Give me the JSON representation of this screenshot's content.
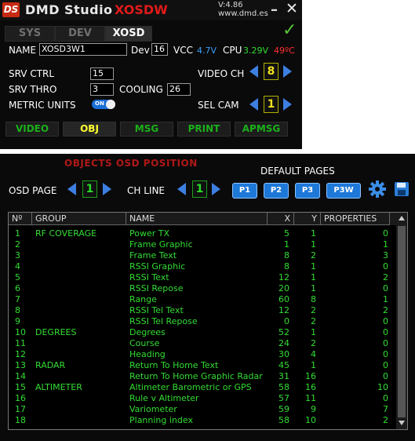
{
  "app": {
    "logo": "DS",
    "title": "DMD Studio",
    "subtitle": "XOSDW",
    "version": "V:4.86",
    "url": "www.dmd.es",
    "minimize": "–",
    "close": "✕",
    "check_icon": "✓"
  },
  "top_tabs": [
    {
      "label": "SYS",
      "active": false
    },
    {
      "label": "DEV",
      "active": false
    },
    {
      "label": "XOSD",
      "active": true
    }
  ],
  "device": {
    "name_label": "NAME",
    "name_value": "XOSD3W1",
    "dev_label": "Dev",
    "dev_value": "16",
    "vcc_label": "VCC",
    "vcc_value": "4.7V",
    "cpu_label": "CPU",
    "cpu_value": "3.29V",
    "temp_value": "49ºC"
  },
  "settings": {
    "srv_ctrl_label": "SRV CTRL",
    "srv_ctrl_value": "15",
    "srv_thro_label": "SRV THRO",
    "srv_thro_value": "3",
    "cooling_label": "COOLING",
    "cooling_value": "26",
    "metric_label": "METRIC UNITS",
    "metric_toggle": "ON",
    "video_ch_label": "VIDEO CH",
    "video_ch_value": "8",
    "sel_cam_label": "SEL CAM",
    "sel_cam_value": "1"
  },
  "bottom_tabs": [
    {
      "label": "VIDEO",
      "active": false
    },
    {
      "label": "OBJ",
      "active": true
    },
    {
      "label": "MSG",
      "active": false
    },
    {
      "label": "PRINT",
      "active": false
    },
    {
      "label": "APMSG",
      "active": false
    }
  ],
  "objects_panel": {
    "title": "OBJECTS OSD POSITION",
    "default_pages_label": "DEFAULT PAGES",
    "osd_page_label": "OSD PAGE",
    "osd_page_value": "1",
    "ch_line_label": "CH LINE",
    "ch_line_value": "1",
    "page_buttons": [
      "P1",
      "P2",
      "P3",
      "P3W"
    ],
    "settings_icon": "gear-icon",
    "save_icon": "floppy-icon"
  },
  "table": {
    "headers": [
      "Nº",
      "GROUP",
      "NAME",
      "X",
      "Y",
      "PROPERTIES"
    ],
    "rows": [
      {
        "n": "1",
        "group": "RF COVERAGE",
        "name": "Power TX",
        "x": "5",
        "y": "1",
        "prop": "0"
      },
      {
        "n": "2",
        "group": "",
        "name": "Frame Graphic",
        "x": "1",
        "y": "1",
        "prop": "1"
      },
      {
        "n": "3",
        "group": "",
        "name": "Frame Text",
        "x": "8",
        "y": "2",
        "prop": "3"
      },
      {
        "n": "4",
        "group": "",
        "name": "RSSI Graphic",
        "x": "8",
        "y": "1",
        "prop": "0"
      },
      {
        "n": "5",
        "group": "",
        "name": "RSSI Text",
        "x": "12",
        "y": "1",
        "prop": "2"
      },
      {
        "n": "6",
        "group": "",
        "name": "RSSI Repose",
        "x": "20",
        "y": "1",
        "prop": "0"
      },
      {
        "n": "7",
        "group": "",
        "name": "Range",
        "x": "60",
        "y": "8",
        "prop": "1"
      },
      {
        "n": "8",
        "group": "",
        "name": "RSSI Tel Text",
        "x": "12",
        "y": "2",
        "prop": "2"
      },
      {
        "n": "9",
        "group": "",
        "name": "RSSI Tel Repose",
        "x": "0",
        "y": "2",
        "prop": "0"
      },
      {
        "n": "10",
        "group": "DEGREES",
        "name": "Degrees",
        "x": "52",
        "y": "1",
        "prop": "0"
      },
      {
        "n": "11",
        "group": "",
        "name": "Course",
        "x": "24",
        "y": "2",
        "prop": "0"
      },
      {
        "n": "12",
        "group": "",
        "name": "Heading",
        "x": "30",
        "y": "4",
        "prop": "0"
      },
      {
        "n": "13",
        "group": "RADAR",
        "name": "Return To Home Text",
        "x": "45",
        "y": "1",
        "prop": "0"
      },
      {
        "n": "14",
        "group": "",
        "name": "Return To Home Graphic Radar",
        "x": "31",
        "y": "16",
        "prop": "0"
      },
      {
        "n": "15",
        "group": "ALTIMETER",
        "name": "Altimeter Barometric or GPS",
        "x": "58",
        "y": "16",
        "prop": "10"
      },
      {
        "n": "16",
        "group": "",
        "name": "Rule v Altimeter",
        "x": "57",
        "y": "11",
        "prop": "0"
      },
      {
        "n": "17",
        "group": "",
        "name": "Variometer",
        "x": "59",
        "y": "9",
        "prop": "7"
      },
      {
        "n": "18",
        "group": "",
        "name": "Planning index",
        "x": "58",
        "y": "10",
        "prop": "2"
      }
    ]
  },
  "colors": {
    "accent_blue": "#1e78d8",
    "text_green": "#33dd33",
    "highlight_yellow": "#ffff30",
    "title_red": "#e01a1a"
  }
}
